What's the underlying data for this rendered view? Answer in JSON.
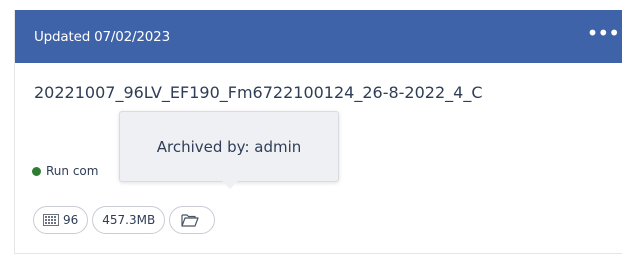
{
  "header": {
    "updated_text": "Updated 07/02/2023",
    "more_icon": "more-horizontal-icon"
  },
  "run": {
    "name": "20221007_96LV_EF190_Fm6722100124_26-8-2022_4_C",
    "status": "Run com"
  },
  "tags": {
    "samples": "96",
    "size": "457.3MB",
    "folder_icon": "folder-icon",
    "grid_icon": "grid-icon"
  },
  "tooltip": {
    "text": "Archived by: admin"
  },
  "colors": {
    "header_bg": "#3f63a8",
    "status_dot": "#2e7d32",
    "text": "#2f3e56"
  }
}
